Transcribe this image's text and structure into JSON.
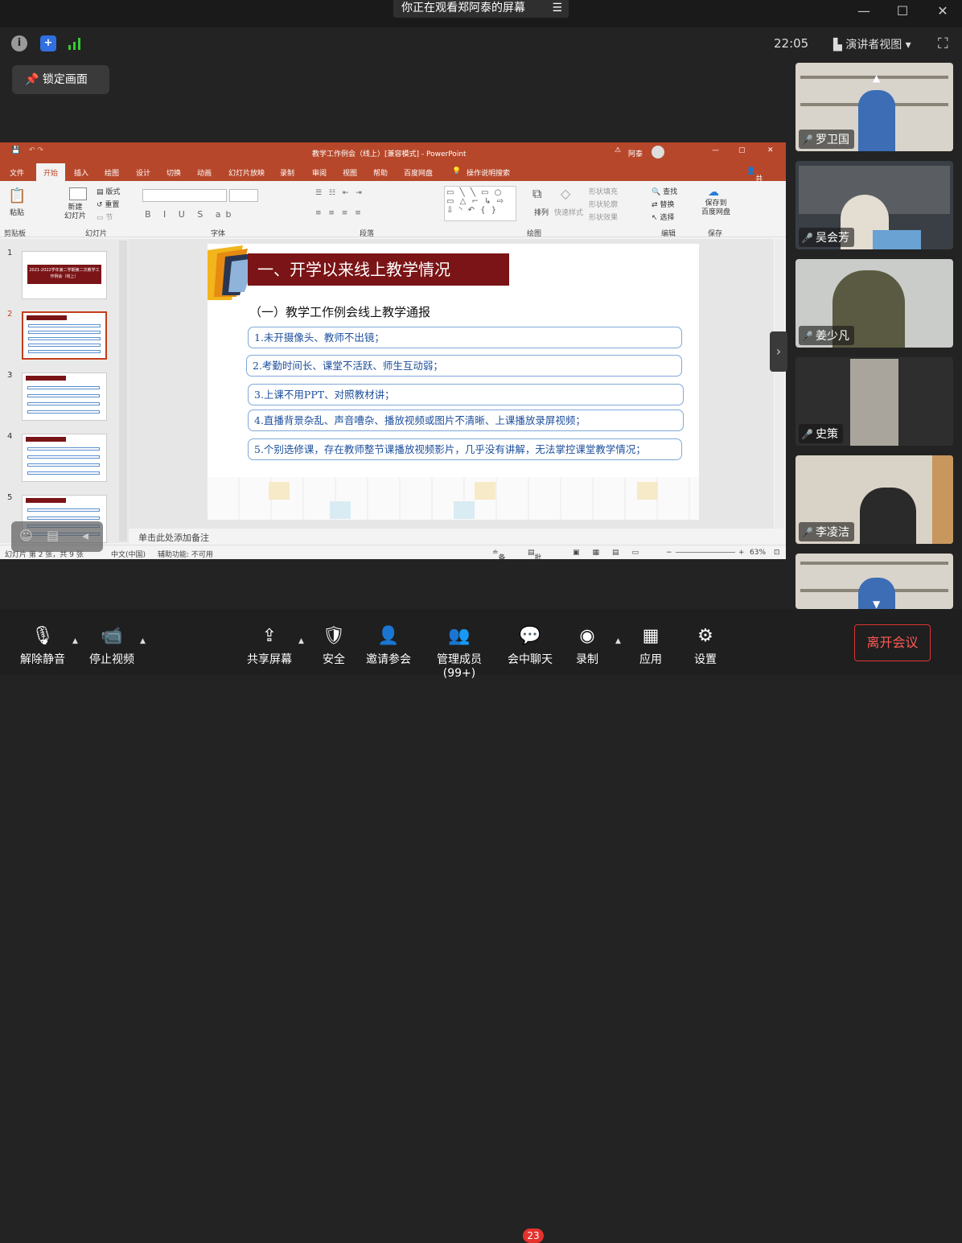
{
  "window": {
    "banner": "你正在观看郑阿泰的屏幕",
    "banner_menu": "☰"
  },
  "status": {
    "time": "22:05",
    "view_label": "演讲者视图"
  },
  "lock": {
    "label": "锁定画面"
  },
  "ppt": {
    "title": "教学工作例会（线上）[兼容模式] - PowerPoint",
    "user": "阿泰",
    "tabs": [
      "文件",
      "开始",
      "插入",
      "绘图",
      "设计",
      "切换",
      "动画",
      "幻灯片放映",
      "录制",
      "审阅",
      "视图",
      "帮助",
      "百度网盘",
      "操作说明搜索"
    ],
    "share": "共享",
    "ribbon": {
      "paste": "粘贴",
      "new_slide": "新建\n幻灯片",
      "layout": "版式",
      "reset": "重置",
      "section": "节",
      "clipboard": "剪贴板",
      "slides": "幻灯片",
      "font": "字体",
      "paragraph": "段落",
      "drawing": "绘图",
      "editing": "编辑",
      "save": "保存",
      "arrange": "排列",
      "quick_styles": "快速样式",
      "shape_fill": "形状填充",
      "shape_outline": "形状轮廓",
      "shape_effect": "形状效果",
      "find": "查找",
      "replace": "替换",
      "select": "选择",
      "save_baidu": "保存到\n百度网盘"
    },
    "thumb_numbers": [
      "1",
      "2",
      "3",
      "4",
      "5"
    ],
    "thumb1_title": "2021-2022学年第二学期第二次教学工作例会（线上）",
    "slide": {
      "header": "一、开学以来线上教学情况",
      "subtitle": "（一）教学工作例会线上教学通报",
      "items": [
        "1.未开摄像头、教师不出镜；",
        "2.考勤时间长、课堂不活跃、师生互动弱；",
        "3.上课不用PPT、对照教材讲；",
        "4.直播背景杂乱、声音嘈杂、播放视频或图片不清晰、上课播放录屏视频；",
        "5.个别选修课，存在教师整节课播放视频影片，几乎没有讲解，无法掌控课堂教学情况；"
      ]
    },
    "notes": "单击此处添加备注",
    "status": {
      "slide": "幻灯片 第 2 张，共 9 张",
      "lang": "中文(中国)",
      "access": "辅助功能: 不可用",
      "notes_btn": "备注",
      "comments_btn": "批注",
      "zoom": "63%"
    }
  },
  "participants": [
    "罗卫国",
    "吴会芳",
    "姜少凡",
    "史策",
    "李凌洁",
    ""
  ],
  "toolbar": {
    "mute": "解除静音",
    "video": "停止视频",
    "share": "共享屏幕",
    "security": "安全",
    "invite": "邀请参会",
    "members": "管理成员(99+)",
    "chat": "会中聊天",
    "chat_badge": "23",
    "record": "录制",
    "apps": "应用",
    "settings": "设置",
    "leave": "离开会议"
  }
}
